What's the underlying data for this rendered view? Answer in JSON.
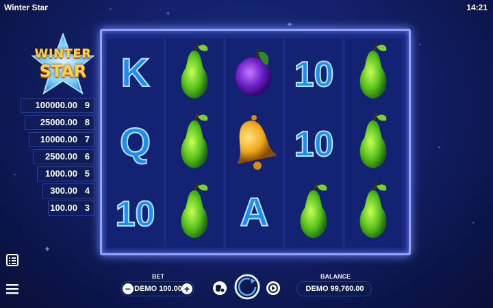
{
  "window": {
    "title": "Winter Star",
    "clock": "14:21"
  },
  "logo": {
    "line1": "WINTER",
    "line2": "STAR"
  },
  "paytable": [
    {
      "amount": "100000.00",
      "count": "9"
    },
    {
      "amount": "25000.00",
      "count": "8"
    },
    {
      "amount": "10000.00",
      "count": "7"
    },
    {
      "amount": "2500.00",
      "count": "6"
    },
    {
      "amount": "1000.00",
      "count": "5"
    },
    {
      "amount": "300.00",
      "count": "4"
    },
    {
      "amount": "100.00",
      "count": "3"
    }
  ],
  "reels": [
    [
      "K",
      "Q",
      "10"
    ],
    [
      "pear",
      "pear",
      "pear"
    ],
    [
      "plum",
      "bell",
      "A"
    ],
    [
      "10",
      "10",
      "pear"
    ],
    [
      "pear",
      "pear",
      "pear"
    ]
  ],
  "controls": {
    "bet_label": "BET",
    "bet_value": "DEMO 100.00",
    "balance_label": "BALANCE",
    "balance_value": "DEMO 99,760.00",
    "minus": "−",
    "plus": "+"
  },
  "colors": {
    "background": "#13206a",
    "frame": "#8ea4ff",
    "accent_gold": "#ffd34a"
  }
}
